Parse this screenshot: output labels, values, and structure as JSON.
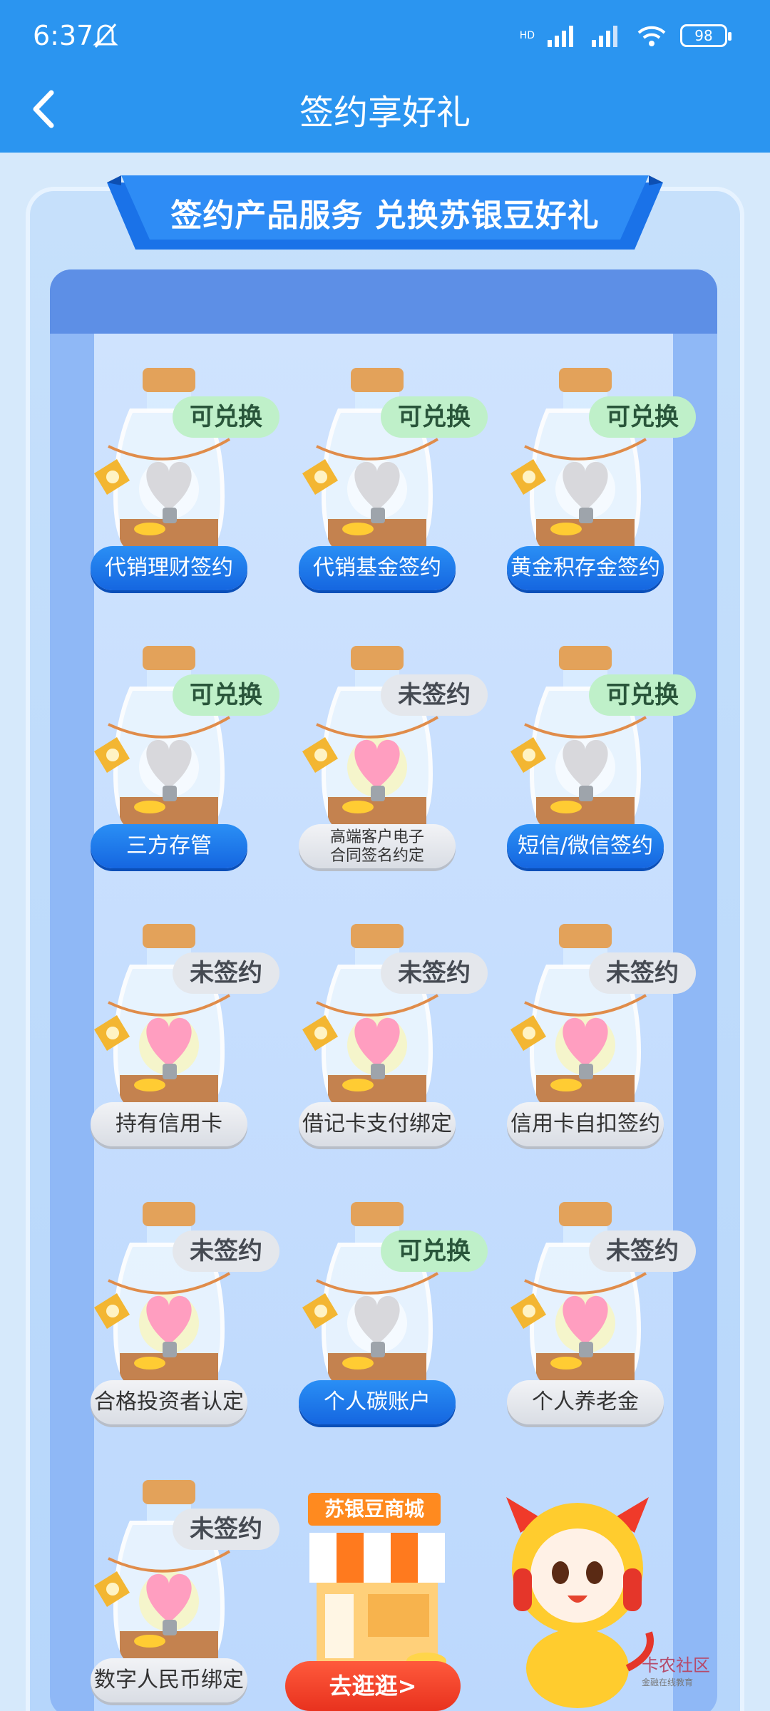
{
  "status": {
    "time": "6:37",
    "network": "HD",
    "battery": "98"
  },
  "nav": {
    "title": "签约享好礼"
  },
  "banner": {
    "title": "签约产品服务 兑换苏银豆好礼"
  },
  "items": [
    {
      "label": "代销理财签约",
      "status": "可兑换"
    },
    {
      "label": "代销基金签约",
      "status": "可兑换"
    },
    {
      "label": "黄金积存金签约",
      "status": "可兑换"
    },
    {
      "label": "三方存管",
      "status": "可兑换"
    },
    {
      "label": "高端客户电子合同签名约定",
      "label_line1": "高端客户电子",
      "label_line2": "合同签名约定",
      "status": "未签约"
    },
    {
      "label": "短信/微信签约",
      "status": "可兑换"
    },
    {
      "label": "持有信用卡",
      "status": "未签约"
    },
    {
      "label": "借记卡支付绑定",
      "status": "未签约"
    },
    {
      "label": "信用卡自扣签约",
      "status": "未签约"
    },
    {
      "label": "合格投资者认定",
      "status": "未签约"
    },
    {
      "label": "个人碳账户",
      "status": "可兑换"
    },
    {
      "label": "个人养老金",
      "status": "未签约"
    },
    {
      "label": "数字人民币绑定",
      "status": "未签约"
    }
  ],
  "shop": {
    "label": "苏银豆商城",
    "button": "去逛逛>"
  },
  "watermark": {
    "text": "卡农社区",
    "sub": "金融在线教育"
  },
  "colors": {
    "header": "#2b95f0",
    "redeem_badge": "#bff0c9",
    "unsigned_badge": "#e4e7ec",
    "active_button": "#1f7cec"
  }
}
